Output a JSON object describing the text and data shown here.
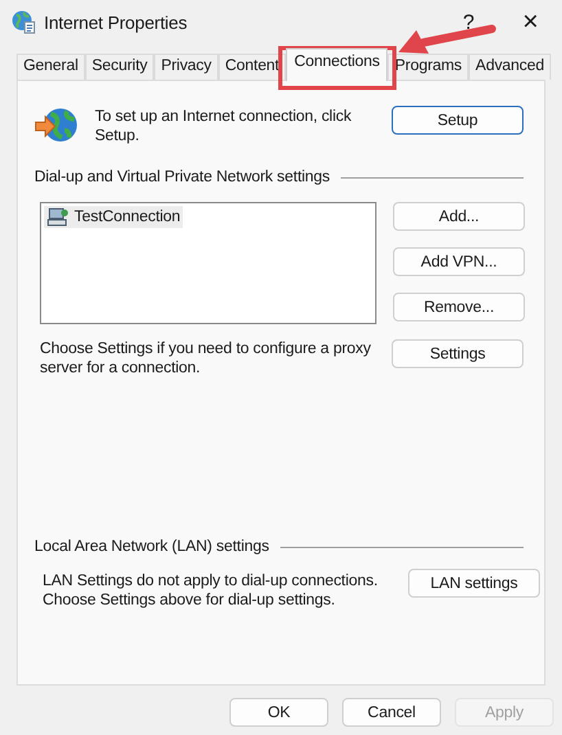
{
  "window": {
    "title": "Internet Properties",
    "help": "?",
    "close": "×"
  },
  "tabs": [
    {
      "label": "General",
      "selected": false
    },
    {
      "label": "Security",
      "selected": false
    },
    {
      "label": "Privacy",
      "selected": false
    },
    {
      "label": "Content",
      "selected": false
    },
    {
      "label": "Connections",
      "selected": true
    },
    {
      "label": "Programs",
      "selected": false
    },
    {
      "label": "Advanced",
      "selected": false
    }
  ],
  "setup": {
    "text": "To set up an Internet connection, click Setup.",
    "button": "Setup"
  },
  "dialup": {
    "heading": "Dial-up and Virtual Private Network settings",
    "connections": [
      {
        "name": "TestConnection",
        "selected": true
      }
    ],
    "buttons": [
      "Add...",
      "Add VPN...",
      "Remove..."
    ],
    "proxy_text": "Choose Settings if you need to configure a proxy server for a connection.",
    "settings_button": "Settings"
  },
  "lan": {
    "heading": "Local Area Network (LAN) settings",
    "text": "LAN Settings do not apply to dial-up connections. Choose Settings above for dial-up settings.",
    "button": "LAN settings"
  },
  "footer_buttons": [
    {
      "label": "OK",
      "disabled": false
    },
    {
      "label": "Cancel",
      "disabled": false
    },
    {
      "label": "Apply",
      "disabled": true
    }
  ]
}
